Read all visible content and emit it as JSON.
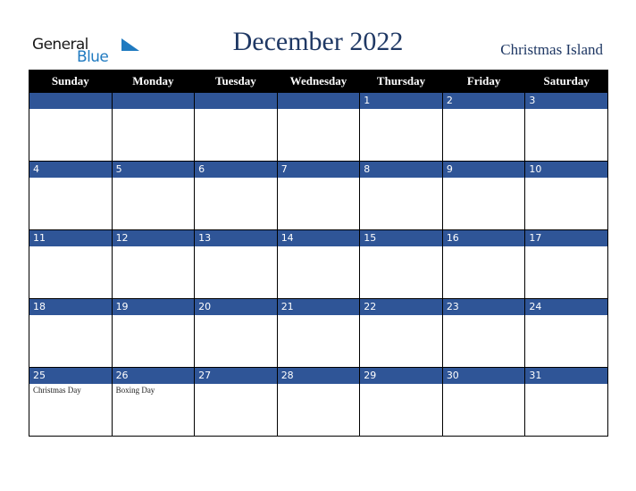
{
  "logo": {
    "line1": "General",
    "line2": "Blue"
  },
  "title": "December 2022",
  "region": "Christmas Island",
  "weekdays": [
    "Sunday",
    "Monday",
    "Tuesday",
    "Wednesday",
    "Thursday",
    "Friday",
    "Saturday"
  ],
  "weeks": [
    [
      {
        "day": "",
        "holiday": ""
      },
      {
        "day": "",
        "holiday": ""
      },
      {
        "day": "",
        "holiday": ""
      },
      {
        "day": "",
        "holiday": ""
      },
      {
        "day": "1",
        "holiday": ""
      },
      {
        "day": "2",
        "holiday": ""
      },
      {
        "day": "3",
        "holiday": ""
      }
    ],
    [
      {
        "day": "4",
        "holiday": ""
      },
      {
        "day": "5",
        "holiday": ""
      },
      {
        "day": "6",
        "holiday": ""
      },
      {
        "day": "7",
        "holiday": ""
      },
      {
        "day": "8",
        "holiday": ""
      },
      {
        "day": "9",
        "holiday": ""
      },
      {
        "day": "10",
        "holiday": ""
      }
    ],
    [
      {
        "day": "11",
        "holiday": ""
      },
      {
        "day": "12",
        "holiday": ""
      },
      {
        "day": "13",
        "holiday": ""
      },
      {
        "day": "14",
        "holiday": ""
      },
      {
        "day": "15",
        "holiday": ""
      },
      {
        "day": "16",
        "holiday": ""
      },
      {
        "day": "17",
        "holiday": ""
      }
    ],
    [
      {
        "day": "18",
        "holiday": ""
      },
      {
        "day": "19",
        "holiday": ""
      },
      {
        "day": "20",
        "holiday": ""
      },
      {
        "day": "21",
        "holiday": ""
      },
      {
        "day": "22",
        "holiday": ""
      },
      {
        "day": "23",
        "holiday": ""
      },
      {
        "day": "24",
        "holiday": ""
      }
    ],
    [
      {
        "day": "25",
        "holiday": "Christmas Day"
      },
      {
        "day": "26",
        "holiday": "Boxing Day"
      },
      {
        "day": "27",
        "holiday": ""
      },
      {
        "day": "28",
        "holiday": ""
      },
      {
        "day": "29",
        "holiday": ""
      },
      {
        "day": "30",
        "holiday": ""
      },
      {
        "day": "31",
        "holiday": ""
      }
    ]
  ],
  "colors": {
    "header_bg": "#000000",
    "day_bar": "#2f5597",
    "title": "#1f3864",
    "logo_blue": "#1f7ac0"
  }
}
